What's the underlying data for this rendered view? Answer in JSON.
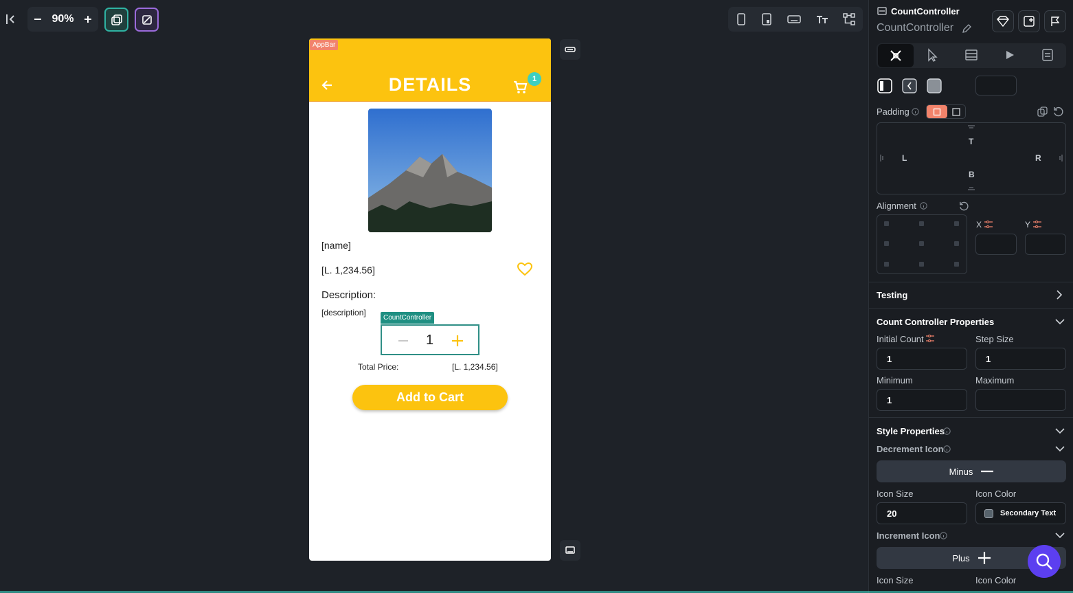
{
  "toolbar": {
    "zoom": "90%",
    "colors": {
      "accent_teal": "#2fb3a3",
      "accent_purple": "#9b6bdc"
    }
  },
  "canvas": {
    "appbar_tag": "AppBar",
    "appbar_title": "DETAILS",
    "cart_badge": "1",
    "name": "[name]",
    "price": "[L. 1,234.56]",
    "description_label": "Description:",
    "description": "[description]",
    "count_tag": "CountController",
    "count_value": "1",
    "total_label": "Total Price:",
    "total_value": "[L. 1,234.56]",
    "add_button": "Add to Cart",
    "colors": {
      "primary": "#fcc30f",
      "teal": "#2f8f86"
    }
  },
  "panel": {
    "widget_type": "CountController",
    "widget_name": "CountController",
    "padding_label": "Padding",
    "pad_t": "T",
    "pad_l": "L",
    "pad_r": "R",
    "pad_b": "B",
    "alignment_label": "Alignment",
    "x_label": "X",
    "y_label": "Y",
    "testing_label": "Testing",
    "count_props_label": "Count Controller Properties",
    "initial_count_label": "Initial Count",
    "initial_count_value": "1",
    "step_size_label": "Step Size",
    "step_size_value": "1",
    "minimum_label": "Minimum",
    "minimum_value": "1",
    "maximum_label": "Maximum",
    "maximum_value": "",
    "style_props_label": "Style Properties",
    "decrement_icon_label": "Decrement Icon",
    "decrement_icon_value": "Minus",
    "icon_size_label": "Icon Size",
    "icon_size_value": "20",
    "icon_color_label": "Icon Color",
    "icon_color_value": "Secondary Text",
    "increment_icon_label": "Increment Icon",
    "increment_icon_value": "Plus",
    "icon_size_label_2": "Icon Size",
    "icon_color_label_2": "Icon Color"
  }
}
